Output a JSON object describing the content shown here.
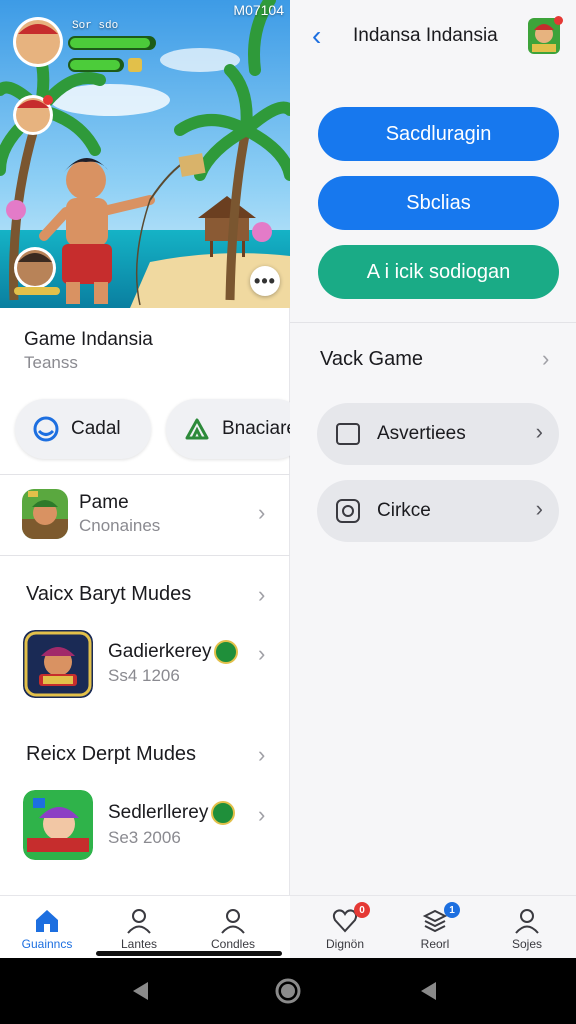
{
  "status_bar": {
    "time": "M07104"
  },
  "hero": {
    "player_tag": "Sor sdo"
  },
  "left_panel": {
    "game_title": "Game Indansia",
    "game_subtitle": "Teanss",
    "pills": [
      {
        "label": "Cadal",
        "icon": "circle-logo-icon"
      },
      {
        "label": "Bnaciare",
        "icon": "house-outline-icon"
      }
    ],
    "featured_row": {
      "title": "Pame",
      "subtitle": "Cnonaines"
    },
    "sections": [
      {
        "title": "Vaicx Baryt Mudes",
        "item": {
          "title": "Gadierkerey",
          "subtitle": "Ss4  1206"
        }
      },
      {
        "title": "Reicx Derpt Mudes",
        "item": {
          "title": "Sedlerllerey",
          "subtitle": "Se3  2006"
        }
      }
    ],
    "bottom_nav": [
      {
        "label": "Guainncs",
        "icon": "home-icon",
        "active": true
      },
      {
        "label": "Lantes",
        "icon": "person-icon",
        "active": false
      },
      {
        "label": "Condles",
        "icon": "person-icon",
        "active": false
      }
    ]
  },
  "right_panel": {
    "title": "Indansa Indansia",
    "buttons": [
      {
        "label": "Sacdluragin",
        "color": "#1778ee"
      },
      {
        "label": "Sbclias",
        "color": "#1778ee"
      },
      {
        "label": "A i icik sodiogan",
        "color": "#1aab86"
      }
    ],
    "section_title": "Vack Game",
    "items": [
      {
        "label": "Asvertiees",
        "icon": "square-outline-icon"
      },
      {
        "label": "Cirkce",
        "icon": "camera-icon"
      }
    ],
    "bottom_nav": [
      {
        "label": "Dignön",
        "icon": "heart-icon",
        "badge": "0",
        "badge_color": "#e53935"
      },
      {
        "label": "Reorl",
        "icon": "layers-icon",
        "badge": "1",
        "badge_color": "#1d6fe0"
      },
      {
        "label": "Sojes",
        "icon": "person-icon",
        "badge": "",
        "badge_color": ""
      }
    ]
  }
}
